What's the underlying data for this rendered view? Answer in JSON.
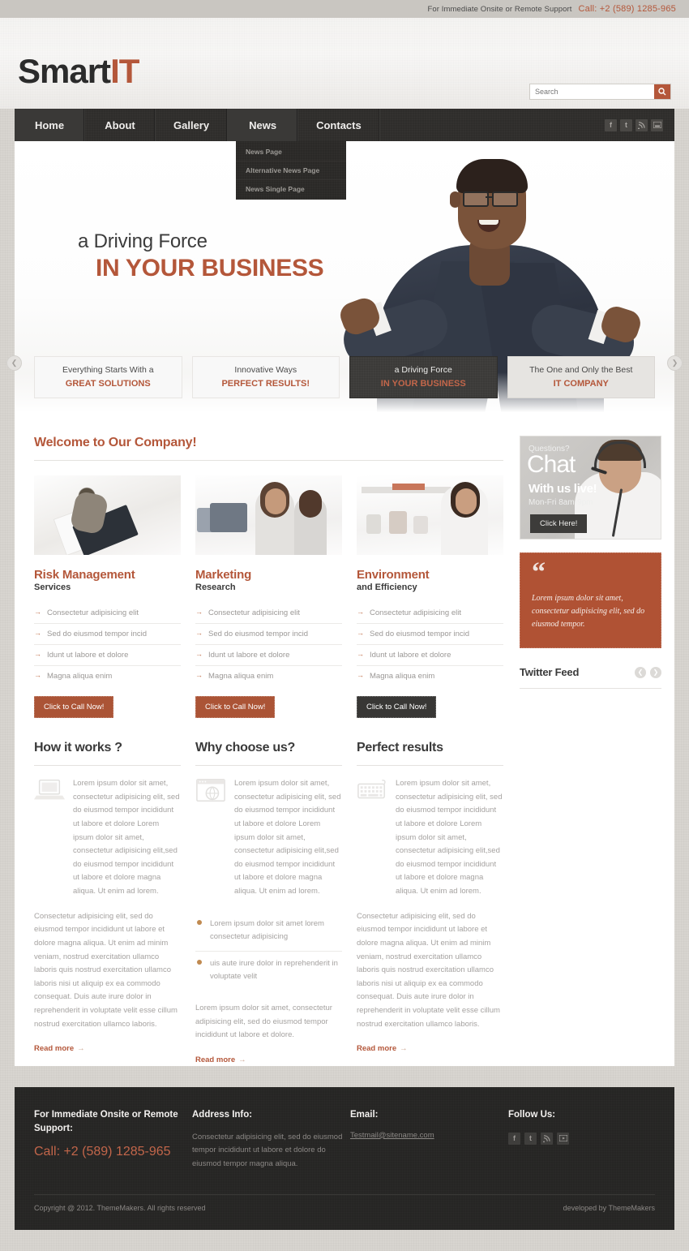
{
  "topbar": {
    "support_text": "For Immediate Onsite or Remote Support",
    "phone": "Call: +2 (589) 1285-965"
  },
  "header": {
    "logo_part1": "Smart",
    "logo_part2": "IT",
    "search_placeholder": "Search",
    "search_value": "",
    "search_icon": "search-icon"
  },
  "nav": {
    "items": [
      {
        "label": "Home",
        "active": true
      },
      {
        "label": "About",
        "active": false
      },
      {
        "label": "Gallery",
        "active": false
      },
      {
        "label": "News",
        "active": true
      },
      {
        "label": "Contacts",
        "active": false
      }
    ],
    "social": [
      "f",
      "t",
      "rss",
      "flickr"
    ],
    "dropdown": {
      "parent": "News",
      "items": [
        "News Page",
        "Alternative News Page",
        "News Single Page"
      ]
    }
  },
  "slider": {
    "title_line1": "a Driving Force",
    "title_line2": "IN YOUR BUSINESS",
    "prev_icon": "chevron-left-icon",
    "next_icon": "chevron-right-icon",
    "thumbs": [
      {
        "top": "Everything Starts With a",
        "bottom": "GREAT SOLUTIONS",
        "style": "light"
      },
      {
        "top": "Innovative Ways",
        "bottom": "PERFECT RESULTS!",
        "style": "light"
      },
      {
        "top": "a Driving Force",
        "bottom": "IN YOUR BUSINESS",
        "style": "dark"
      },
      {
        "top": "The One and Only the Best",
        "bottom": "IT COMPANY",
        "style": "gray"
      }
    ]
  },
  "main": {
    "welcome_title": "Welcome to Our Company!",
    "cards": [
      {
        "title": "Risk Management",
        "subtitle": "Services",
        "items": [
          "Consectetur adipisicing elit",
          "Sed do eiusmod tempor incid",
          "Idunt ut labore et dolore",
          "Magna aliqua enim"
        ],
        "cta": "Click to Call Now!",
        "cta_style": "accent"
      },
      {
        "title": "Marketing",
        "subtitle": "Research",
        "items": [
          "Consectetur adipisicing elit",
          "Sed do eiusmod tempor incid",
          "Idunt ut labore et dolore",
          "Magna aliqua enim"
        ],
        "cta": "Click to Call Now!",
        "cta_style": "accent"
      },
      {
        "title": "Environment",
        "subtitle": "and Efficiency",
        "items": [
          "Consectetur adipisicing elit",
          "Sed do eiusmod tempor incid",
          "Idunt ut labore et dolore",
          "Magna aliqua enim"
        ],
        "cta": "Click to Call Now!",
        "cta_style": "dark"
      }
    ],
    "lower": [
      {
        "heading": "How it works ?",
        "icon": "laptop-icon",
        "intro": "Lorem ipsum dolor sit amet, consectetur adipisicing elit, sed do eiusmod tempor incididunt ut labore et dolore Lorem ipsum dolor sit amet, consectetur adipisicing elit,sed do eiusmod tempor incididunt ut labore et dolore magna aliqua. Ut enim ad lorem.",
        "body": "Consectetur adipisicing elit, sed do eiusmod tempor incididunt ut labore et dolore magna aliqua. Ut enim ad minim veniam, nostrud exercitation ullamco laboris quis nostrud exercitation ullamco laboris nisi ut aliquip ex ea commodo consequat. Duis aute irure dolor in reprehenderit in voluptate velit esse cillum nostrud exercitation ullamco laboris.",
        "read_more": "Read more"
      },
      {
        "heading": "Why choose us?",
        "icon": "browser-globe-icon",
        "intro": "Lorem ipsum dolor sit amet, consectetur adipisicing elit, sed do eiusmod tempor incididunt ut labore et dolore Lorem ipsum dolor sit amet, consectetur adipisicing elit,sed do eiusmod tempor incididunt ut labore et dolore magna aliqua. Ut enim ad lorem.",
        "bullets": [
          "Lorem ipsum dolor sit amet lorem consectetur adipisicing",
          "uis aute irure dolor in reprehenderit in voluptate velit"
        ],
        "body": "Lorem ipsum dolor sit amet, consectetur adipisicing elit, sed do eiusmod tempor incididunt ut labore et dolore.",
        "read_more": "Read more"
      },
      {
        "heading": "Perfect results",
        "icon": "keyboard-icon",
        "intro": "Lorem ipsum dolor sit amet, consectetur adipisicing elit, sed do eiusmod tempor incididunt ut labore et dolore Lorem ipsum dolor sit amet, consectetur adipisicing elit,sed do eiusmod tempor incididunt ut labore et dolore magna aliqua. Ut enim ad lorem.",
        "body": "Consectetur adipisicing elit, sed do eiusmod tempor incididunt ut labore et dolore magna aliqua. Ut enim ad minim veniam, nostrud exercitation ullamco laboris quis nostrud exercitation ullamco laboris nisi ut aliquip ex ea commodo consequat. Duis aute irure dolor in reprehenderit in voluptate velit esse cillum nostrud exercitation ullamco laboris.",
        "read_more": "Read more"
      }
    ]
  },
  "sidebar": {
    "chat": {
      "question": "Questions?",
      "headline": "Chat",
      "subline": "With us live!",
      "hours": "Mon-Fri 8am-9pm",
      "button": "Click Here!"
    },
    "quote": {
      "mark": "“",
      "text": "Lorem ipsum dolor sit amet, consectetur adipisicing elit, sed do eiusmod tempor."
    },
    "twitter": {
      "title": "Twitter Feed",
      "prev_icon": "chevron-left-icon",
      "next_icon": "chevron-right-icon"
    }
  },
  "footer": {
    "col1_heading": "For Immediate Onsite or Remote Support:",
    "col1_phone": "Call: +2 (589) 1285-965",
    "col2_heading": "Address Info:",
    "col2_text": "Consectetur adipisicing elit, sed do eiusmod tempor incididunt ut labore et dolore do eiusmod tempor magna aliqua.",
    "col3_heading": "Email:",
    "col3_email": "Testmail@sitename.com",
    "col4_heading": "Follow Us:",
    "social": [
      "f",
      "t",
      "rss",
      "youtube"
    ],
    "copyright": "Copyright @ 2012. ThemeMakers. All rights reserved",
    "developed": "developed by ThemeMakers"
  },
  "colors": {
    "accent": "#b4573a",
    "accent_button": "#ab5436",
    "quote_bg": "#b05234",
    "dark": "#2e2d2b",
    "footer_bg": "#262524"
  }
}
